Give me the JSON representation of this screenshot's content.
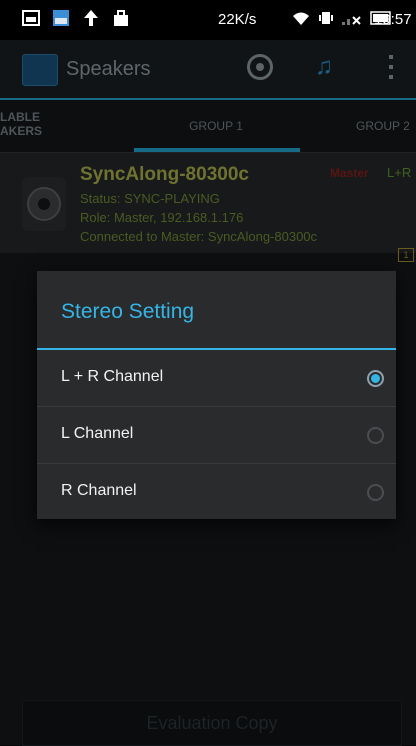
{
  "status_bar": {
    "net_speed": "22K/s",
    "time": "19:57",
    "icons": [
      "gallery-icon",
      "photo-icon",
      "upload-arrow-icon",
      "bag-icon",
      "wifi-icon",
      "vibrate-icon",
      "signal-icon",
      "battery-icon"
    ]
  },
  "app": {
    "title": "Speakers",
    "actions": [
      "speaker-icon",
      "music-note-icon",
      "overflow-menu-icon"
    ]
  },
  "tabs": [
    {
      "label": "LABLE\nAKERS"
    },
    {
      "label": "GROUP 1"
    },
    {
      "label": "GROUP 2"
    }
  ],
  "device": {
    "name": "SyncAlong-80300c",
    "status": "Status: SYNC-PLAYING",
    "role": "Role: Master,  192.168.1.176",
    "connected": "Connected to Master: SyncAlong-80300c",
    "mode": "Master",
    "channel": "L+R",
    "badge": "1"
  },
  "dialog": {
    "title": "Stereo Setting",
    "options": [
      {
        "label": "L + R  Channel",
        "selected": true
      },
      {
        "label": "L Channel",
        "selected": false
      },
      {
        "label": "R Channel",
        "selected": false
      }
    ]
  },
  "footer": {
    "button": "Evaluation Copy"
  },
  "colors": {
    "accent": "#35b5e5",
    "dialog_bg": "#2a2b2d"
  }
}
